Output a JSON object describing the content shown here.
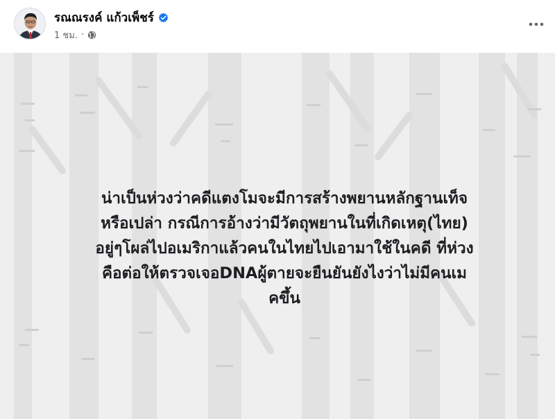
{
  "post": {
    "author": "รณณรงค์ แก้วเพ็ชร์",
    "verified": true,
    "timestamp": "1 ชม.",
    "separator": "·",
    "privacy_icon": "globe-icon",
    "more_icon": "more-options-icon",
    "text_lines": [
      "น่าเป็นห่วงว่าคดีแตงโมจะมีการสร้างพยานหลักฐานเท็จ",
      "หรือเปล่า กรณีการอ้างว่ามีวัตถุพยานในที่เกิดเหตุ(ไทย)",
      "อยู่ๆโผล่ไปอเมริกาแล้วคนในไทยไปเอามาใช้ในคดี ที่ห่วง",
      "คือต่อให้ตรวจเจอDNAผู้ตายจะยืนยันยังไงว่าไม่มีคนเม",
      "คขึ้น"
    ]
  },
  "colors": {
    "verified_badge": "#1877f2",
    "meta_text": "#65676b",
    "background_card": "#efefef",
    "trees": "#dcdcdc",
    "text": "#1c1e21"
  }
}
